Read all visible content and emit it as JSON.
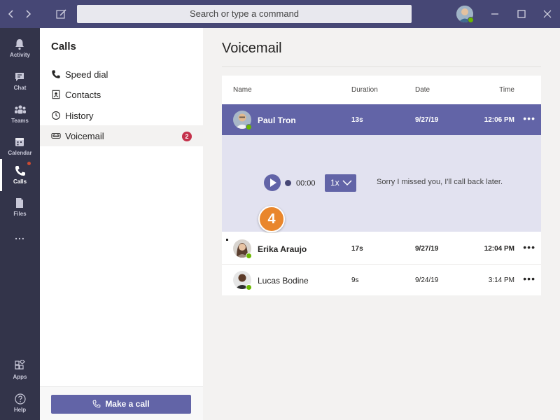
{
  "titlebar": {
    "search_placeholder": "Search or type a command",
    "back_icon": "chevron-left-icon",
    "forward_icon": "chevron-right-icon",
    "compose_icon": "compose-icon"
  },
  "rail": {
    "items": [
      {
        "label": "Activity",
        "icon": "bell-icon"
      },
      {
        "label": "Chat",
        "icon": "chat-icon"
      },
      {
        "label": "Teams",
        "icon": "teams-icon"
      },
      {
        "label": "Calendar",
        "icon": "calendar-icon"
      },
      {
        "label": "Calls",
        "icon": "phone-icon"
      },
      {
        "label": "Files",
        "icon": "file-icon"
      },
      {
        "label": "Apps",
        "icon": "apps-icon"
      },
      {
        "label": "Help",
        "icon": "help-icon"
      }
    ],
    "more": "..."
  },
  "calls_panel": {
    "title": "Calls",
    "items": [
      {
        "label": "Speed dial",
        "icon": "phone-icon"
      },
      {
        "label": "Contacts",
        "icon": "contacts-icon"
      },
      {
        "label": "History",
        "icon": "clock-icon"
      },
      {
        "label": "Voicemail",
        "icon": "voicemail-icon",
        "badge": "2"
      }
    ],
    "make_call_label": "Make a call"
  },
  "voicemail": {
    "title": "Voicemail",
    "columns": {
      "name": "Name",
      "duration": "Duration",
      "date": "Date",
      "time": "Time"
    },
    "rows": [
      {
        "name": "Paul Tron",
        "duration": "13s",
        "date": "9/27/19",
        "time": "12:06 PM",
        "more": "•••"
      },
      {
        "name": "Erika Araujo",
        "duration": "17s",
        "date": "9/27/19",
        "time": "12:04 PM",
        "more": "•••"
      },
      {
        "name": "Lucas Bodine",
        "duration": "9s",
        "date": "9/24/19",
        "time": "3:14 PM",
        "more": "•••"
      }
    ],
    "player": {
      "position": "00:00",
      "speed": "1x",
      "transcript": "Sorry I missed you, I'll call back later."
    },
    "step_badge": "4"
  },
  "colors": {
    "titlebar": "#464775",
    "rail": "#33344a",
    "accent": "#6264a7",
    "badge": "#c4314b",
    "step": "#e9862c",
    "online": "#6bb700"
  }
}
